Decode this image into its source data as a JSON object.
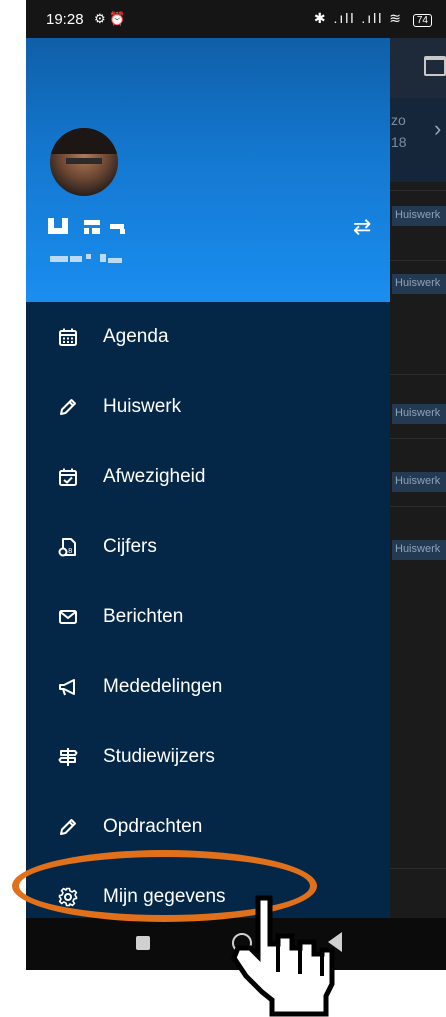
{
  "status_bar": {
    "time": "19:28",
    "left_icons": "⚙ ⏰",
    "right_icons": "✱ .ıll .ıll ≋",
    "battery": "74"
  },
  "background": {
    "day_name": "zo",
    "day_number": "18",
    "homework_tags": [
      "Huiswerk",
      "Huiswerk",
      "Huiswerk",
      "Huiswerk",
      "Huiswerk"
    ]
  },
  "drawer": {
    "switch_icon": "⇄",
    "menu": [
      {
        "label": "Agenda",
        "icon": "calendar-icon"
      },
      {
        "label": "Huiswerk",
        "icon": "pencil-icon"
      },
      {
        "label": "Afwezigheid",
        "icon": "calendar-check-icon"
      },
      {
        "label": "Cijfers",
        "icon": "grade-file-icon"
      },
      {
        "label": "Berichten",
        "icon": "envelope-icon"
      },
      {
        "label": "Mededelingen",
        "icon": "megaphone-icon"
      },
      {
        "label": "Studiewijzers",
        "icon": "signpost-icon"
      },
      {
        "label": "Opdrachten",
        "icon": "pencil-icon"
      },
      {
        "label": "Mijn gegevens",
        "icon": "gear-icon"
      }
    ]
  },
  "colors": {
    "drawer_bg": "#052747",
    "header_gradient_top": "#0f5fa8",
    "header_gradient_bottom": "#1a8ef0",
    "highlight_ring": "#e0711a"
  }
}
